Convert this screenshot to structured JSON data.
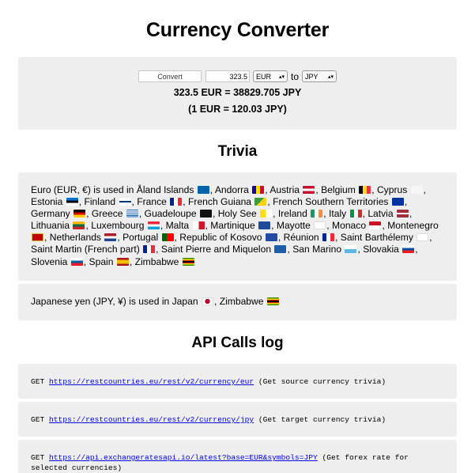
{
  "title": "Currency Converter",
  "converter": {
    "convert_label": "Convert",
    "amount": "323.5",
    "from_currency": "EUR",
    "to_word": "to",
    "to_currency": "JPY",
    "result": "323.5 EUR = 38829.705 JPY",
    "rate": "(1 EUR = 120.03 JPY)"
  },
  "trivia": {
    "title": "Trivia",
    "source_intro": "Euro (EUR, €) is used in",
    "source_countries": [
      {
        "name": "Åland Islands",
        "flag": "ax"
      },
      {
        "name": "Andorra",
        "flag": "ad"
      },
      {
        "name": "Austria",
        "flag": "at"
      },
      {
        "name": "Belgium",
        "flag": "be"
      },
      {
        "name": "Cyprus",
        "flag": "cy"
      },
      {
        "name": "Estonia",
        "flag": "ee"
      },
      {
        "name": "Finland",
        "flag": "fi"
      },
      {
        "name": "France",
        "flag": "fr"
      },
      {
        "name": "French Guiana",
        "flag": "gf"
      },
      {
        "name": "French Southern Territories",
        "flag": "tf"
      },
      {
        "name": "Germany",
        "flag": "de"
      },
      {
        "name": "Greece",
        "flag": "gr"
      },
      {
        "name": "Guadeloupe",
        "flag": "gp"
      },
      {
        "name": "Holy See",
        "flag": "va"
      },
      {
        "name": "Ireland",
        "flag": "ie"
      },
      {
        "name": "Italy",
        "flag": "it"
      },
      {
        "name": "Latvia",
        "flag": "lv"
      },
      {
        "name": "Lithuania",
        "flag": "lt"
      },
      {
        "name": "Luxembourg",
        "flag": "lu"
      },
      {
        "name": "Malta",
        "flag": "mt"
      },
      {
        "name": "Martinique",
        "flag": "mq"
      },
      {
        "name": "Mayotte",
        "flag": "yt"
      },
      {
        "name": "Monaco",
        "flag": "mc"
      },
      {
        "name": "Montenegro",
        "flag": "me"
      },
      {
        "name": "Netherlands",
        "flag": "nl"
      },
      {
        "name": "Portugal",
        "flag": "pt"
      },
      {
        "name": "Republic of Kosovo",
        "flag": "xk"
      },
      {
        "name": "Réunion",
        "flag": "re"
      },
      {
        "name": "Saint Barthélemy",
        "flag": "bl"
      },
      {
        "name": "Saint Martin (French part)",
        "flag": "mf"
      },
      {
        "name": "Saint Pierre and Miquelon",
        "flag": "pm"
      },
      {
        "name": "San Marino",
        "flag": "sm"
      },
      {
        "name": "Slovakia",
        "flag": "sk"
      },
      {
        "name": "Slovenia",
        "flag": "si"
      },
      {
        "name": "Spain",
        "flag": "es"
      },
      {
        "name": "Zimbabwe",
        "flag": "zw"
      }
    ],
    "target_intro": "Japanese yen (JPY, ¥) is used in",
    "target_countries": [
      {
        "name": "Japan",
        "flag": "jp"
      },
      {
        "name": "Zimbabwe",
        "flag": "zw"
      }
    ]
  },
  "api_log": {
    "title": "API Calls log",
    "entries": [
      {
        "method": "GET",
        "url": "https://restcountries.eu/rest/v2/currency/eur",
        "note": "(Get source currency trivia)"
      },
      {
        "method": "GET",
        "url": "https://restcountries.eu/rest/v2/currency/jpy",
        "note": "(Get target currency trivia)"
      },
      {
        "method": "GET",
        "url": "https://api.exchangeratesapi.io/latest?base=EUR&symbols=JPY",
        "note": "(Get forex rate for selected currencies)"
      }
    ]
  }
}
